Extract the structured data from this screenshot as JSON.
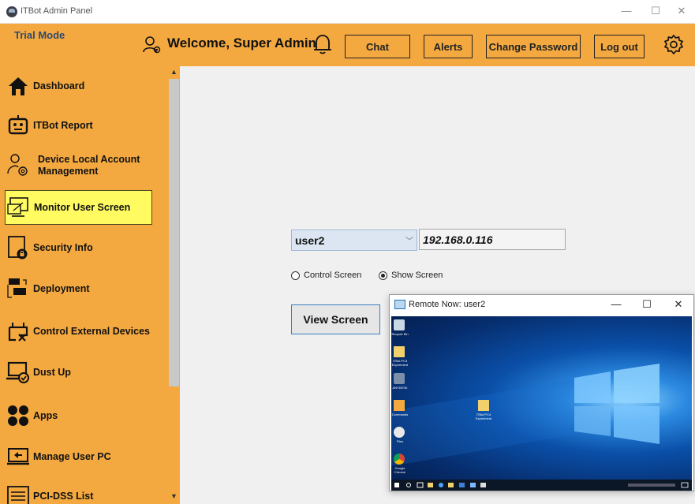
{
  "window": {
    "title": "ITBot Admin Panel",
    "min": "—",
    "max": "☐",
    "close": "✕"
  },
  "header": {
    "mode": "Trial Mode",
    "welcome": "Welcome, Super Admin",
    "buttons": [
      "Chat",
      "Alerts",
      "Change Password",
      "Log out"
    ]
  },
  "sidebar": {
    "items": [
      {
        "label": "Dashboard",
        "icon": "home-icon"
      },
      {
        "label": "ITBot Report",
        "icon": "robot-icon"
      },
      {
        "label": "Device Local Account Management",
        "icon": "user-gear-icon"
      },
      {
        "label": "Monitor User Screen",
        "icon": "monitor-icon",
        "active": true
      },
      {
        "label": "Security Info",
        "icon": "lock-document-icon"
      },
      {
        "label": "Deployment",
        "icon": "deployment-icon"
      },
      {
        "label": "Control External Devices",
        "icon": "usb-device-icon"
      },
      {
        "label": "Dust Up",
        "icon": "laptop-check-icon"
      },
      {
        "label": "Apps",
        "icon": "apps-icon"
      },
      {
        "label": "Manage User PC",
        "icon": "laptop-icon"
      },
      {
        "label": "PCI-DSS List",
        "icon": "list-icon"
      }
    ]
  },
  "main": {
    "user_select": "user2",
    "ip": "192.168.0.116",
    "radio_control": "Control Screen",
    "radio_show": "Show Screen",
    "selected_mode": "Show Screen",
    "view_button": "View Screen"
  },
  "remote_window": {
    "title": "Remote Now: user2",
    "desktop_icons": [
      "Recycle Bin",
      "ITBot PC4 Experiment",
      "ANYDESK",
      "Commands",
      "Files",
      "Google Chrome"
    ],
    "desktop_folder": "ITBot PC4 Experiment"
  },
  "colors": {
    "accent": "#f4a940",
    "active": "#fffb61",
    "trial_text": "#2c4a73"
  }
}
